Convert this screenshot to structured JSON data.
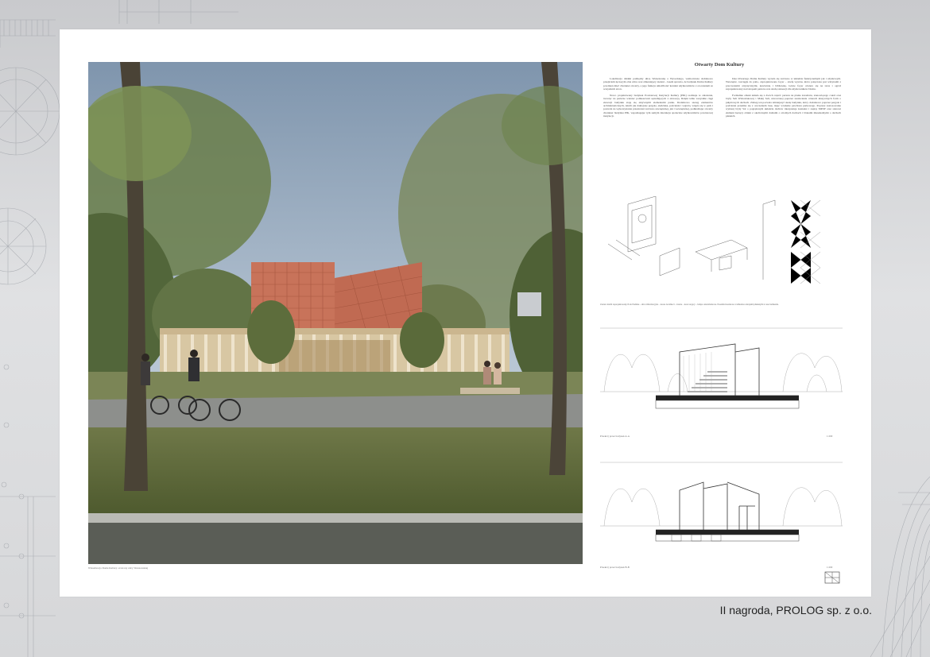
{
  "board": {
    "title": "Otwarty Dom Kultury",
    "col1_p1": "Lokalizacja działki pomiędzy ulicą Warszawską a Wysockiego, wzmocniona dodatkowo przejściem łączącym obie ulice oraz zmieniający zieleni – lasem sprawia, że budynek Domu Kultury powinien mieć charakter otwarty, a jego funkcja umożliwiać kontakt użytkowników z otoczeniem ze wszystkich stron.",
    "col1_p2": "Nowo projektowany budynek Powiatowej Instytucji Kultury (PIK) realizuje te założenia, tworząc na parterze wieniec pomieszczeń sąsiadujących z elewacją. Dzięki temu wszystkie ciągi elewacji budynku stają się aktywnymi elementami parku. Dodatkowo szereg elementów architektonicznych, takich jak doklejone pergole, siedziska, podcienia i wejścia, wtapia się w park i pozwala na wykorzystanie przestrzeni zarówno zewnętrznej, jak i wewnętrznej, podkreślając otwarty charakter budynku PIK, wspomagając tym samym interakcje społeczne użytkowników powiatowej instytucji.",
    "col2_p1": "Idea Otwartego Domu Kultury wyraża się zarówno w układzie funkcjonalnym jak i użytkowym. Wewnątrz, rozciągłe do patio, zaprojektowano foyer – strefę wystaw, która połączona jest witrynami z pracowniami artystycznymi, kawiarnią i biblioteką. Górne foyer otwiera się na taras i ogród zaprojektowany nad stropem parteru oraz strefę rekreacji dla użytkowników Domu.",
    "col2_p2": "Formalnie obiekt składa się z dwóch części: parteru na planie kwadratu, stanowiącego cokół oraz bryły Sali Widowiskowej i Małej Sali, utworzonej poprzez zestawienie czterech klasycznych form o pulpitowych dachach. Zabieg ten pozwala zmniejszyć skalę budynku, który dodatkowo poprzez pergole i podcienia przenika się z otoczeniem lasu, dając wrażenie pawilonu parkowego. Poprzez zastosowanie wyższej bryły Sal o pogrążonym układzie dachów interpretuje kontekst i zapisy MPZP oraz stanowi element łączący obiekt z okolicznymi domami o stromych dachach i blokami mieszkalnymi o dachach płaskich.",
    "render_caption": "Wizualizacja Domu Kultury od strony ulicy Warszawskiej",
    "axo_note": "Zestaw mebli zaprojektowanych do Parkiku – ulica informacyjna – kosze na śmieci – ławka – kosz stojący – lampa oświetleniowa. Posadzki kostkowe z kilkoma rodzajami płukanymi w uszczelnieniu.",
    "section_a_label": "Przekrój przez budynek A-A",
    "section_a_scale": "1:200",
    "section_b_label": "Przekrój przez budynek B-B",
    "section_b_scale": "1:200"
  },
  "award": "II nagroda, PROLOG sp. z o.o.",
  "colors": {
    "background": "#d9dadc",
    "board": "#ffffff",
    "facade": "#c8735a",
    "pergola": "#d6c3a0",
    "grass": "#5f6b3a",
    "sky": "#9fb3c9"
  }
}
